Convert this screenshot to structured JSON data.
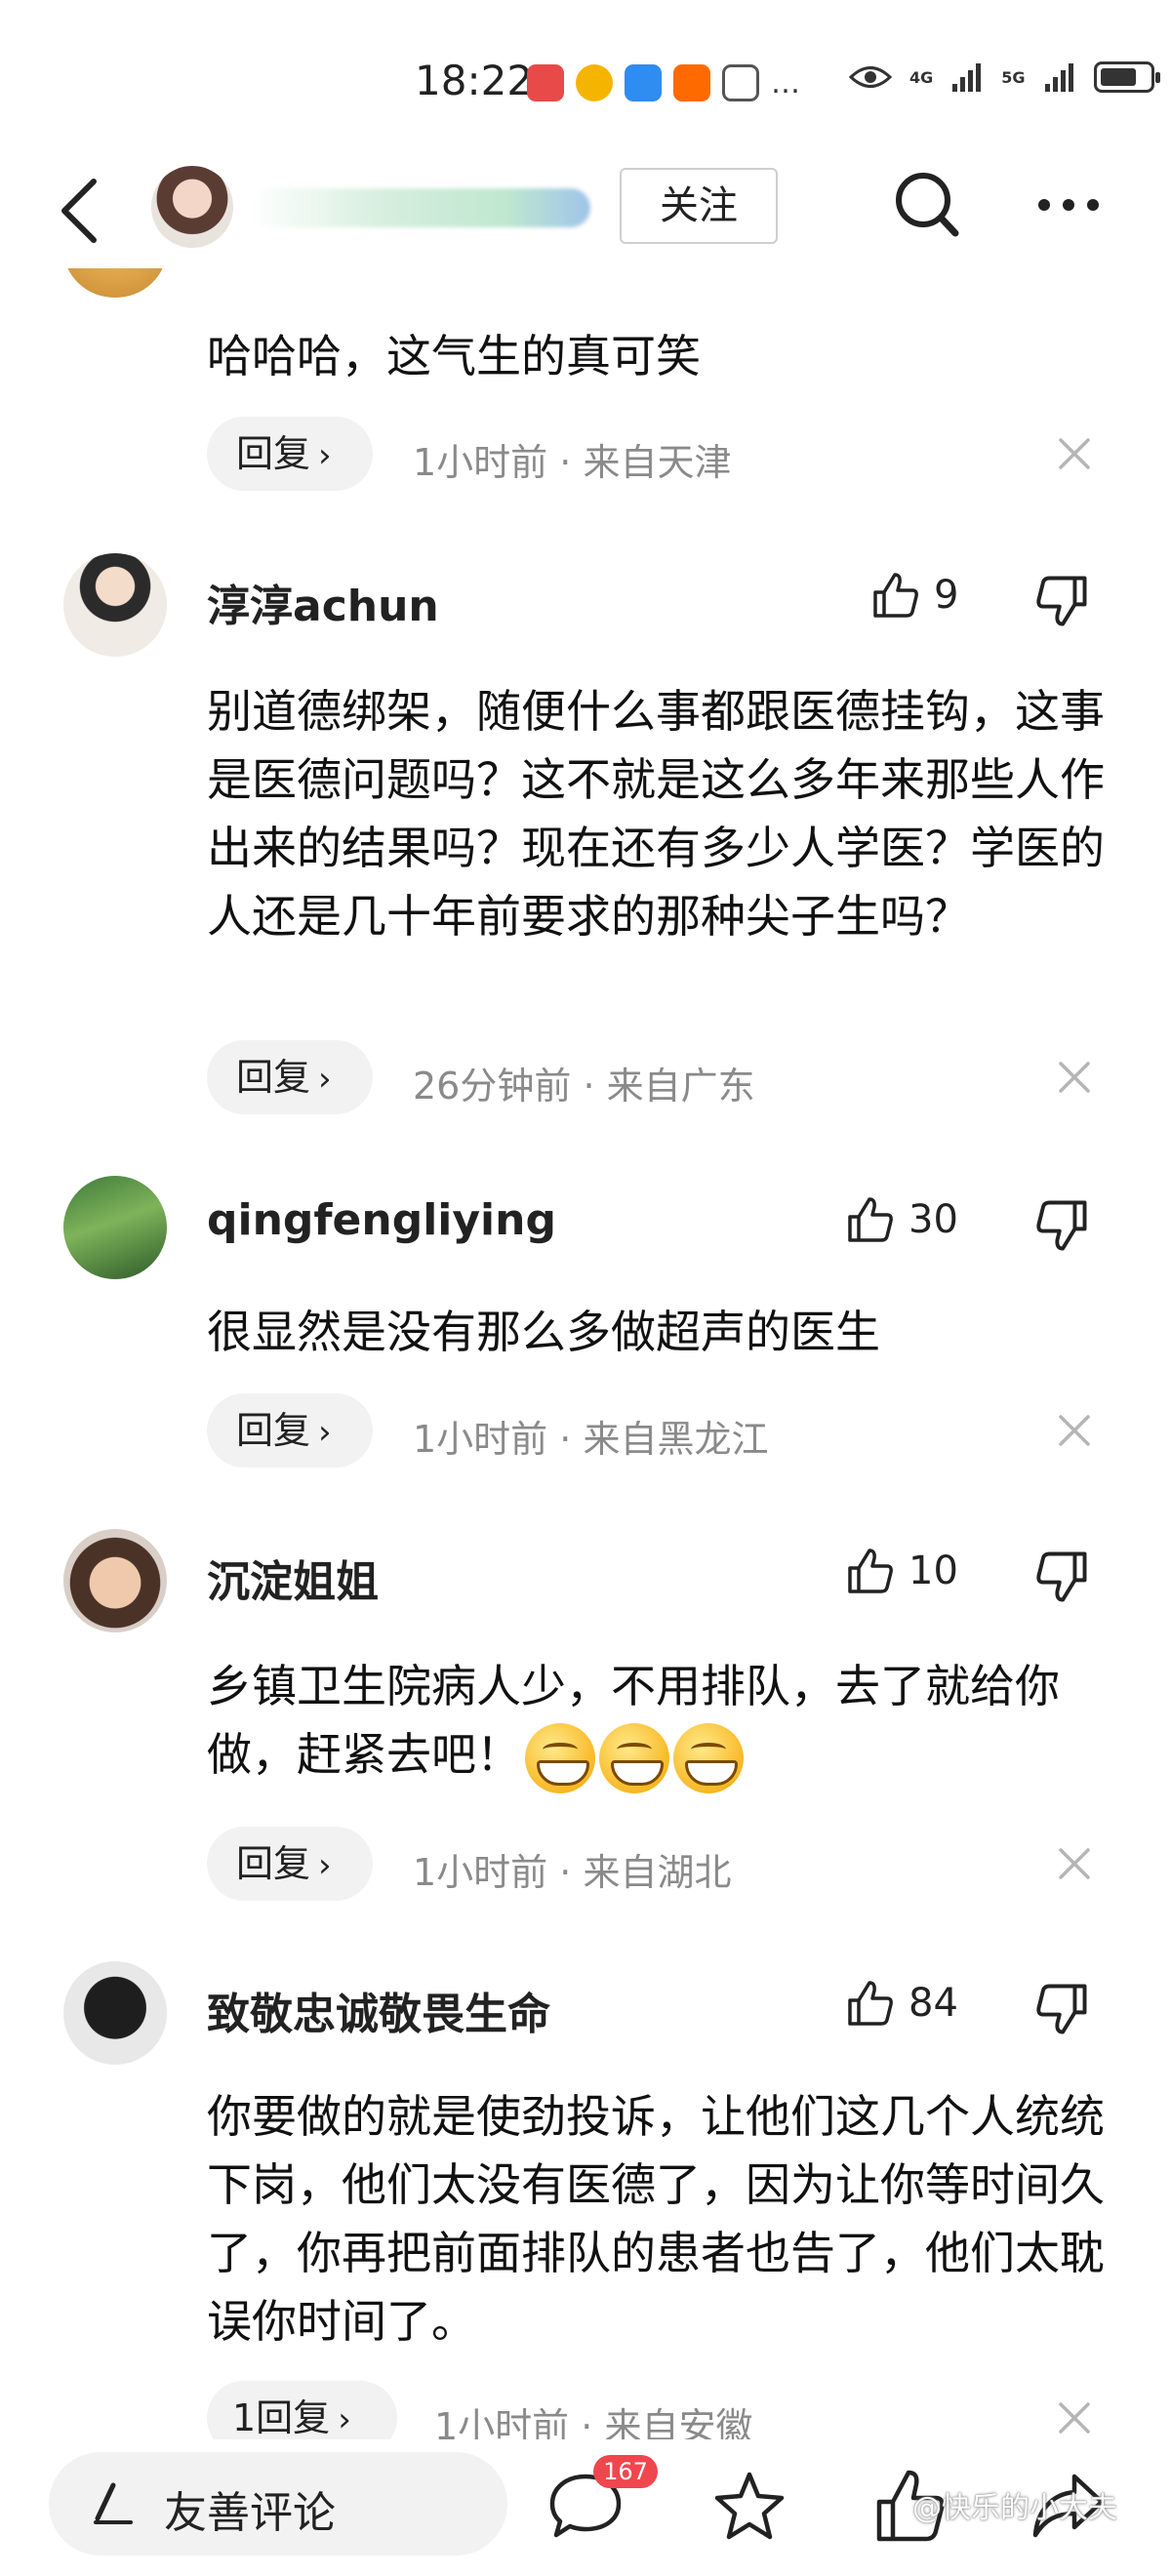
{
  "status_bar": {
    "time": "18:22",
    "network_1": "4G",
    "network_2": "5G",
    "overflow": "…"
  },
  "header": {
    "follow_label": "关注"
  },
  "comments": [
    {
      "text": "哈哈哈，这气生的真可笑",
      "reply_label": "回复",
      "time": "1小时前",
      "location": "来自天津"
    },
    {
      "author": "淳淳achun",
      "likes": "9",
      "text": "别道德绑架，随便什么事都跟医德挂钩，这事是医德问题吗？这不就是这么多年来那些人作出来的结果吗？现在还有多少人学医？学医的人还是几十年前要求的那种尖子生吗？",
      "reply_label": "回复",
      "time": "26分钟前",
      "location": "来自广东"
    },
    {
      "author": "qingfengliying",
      "likes": "30",
      "text": "很显然是没有那么多做超声的医生",
      "reply_label": "回复",
      "time": "1小时前",
      "location": "来自黑龙江"
    },
    {
      "author": "沉淀姐姐",
      "likes": "10",
      "text": "乡镇卫生院病人少，不用排队，去了就给你做，赶紧去吧！",
      "reply_label": "回复",
      "time": "1小时前",
      "location": "来自湖北"
    },
    {
      "author": "致敬忠诚敬畏生命",
      "likes": "84",
      "text": "你要做的就是使劲投诉，让他们这几个人统统下岗，他们太没有医德了，因为让你等时间久了，你再把前面排队的患者也告了，他们太耽误你时间了。",
      "reply_label": "1回复",
      "time": "1小时前",
      "location": "来自安徽"
    }
  ],
  "bottom_bar": {
    "comment_placeholder": "友善评论",
    "comment_count": "167",
    "watermark": "@快乐的小大夫"
  },
  "meta_separator": " · ",
  "colors": {
    "badge": "#f0464e",
    "meta_text": "#8a8a8a",
    "pill_bg": "#f2f2f2"
  }
}
